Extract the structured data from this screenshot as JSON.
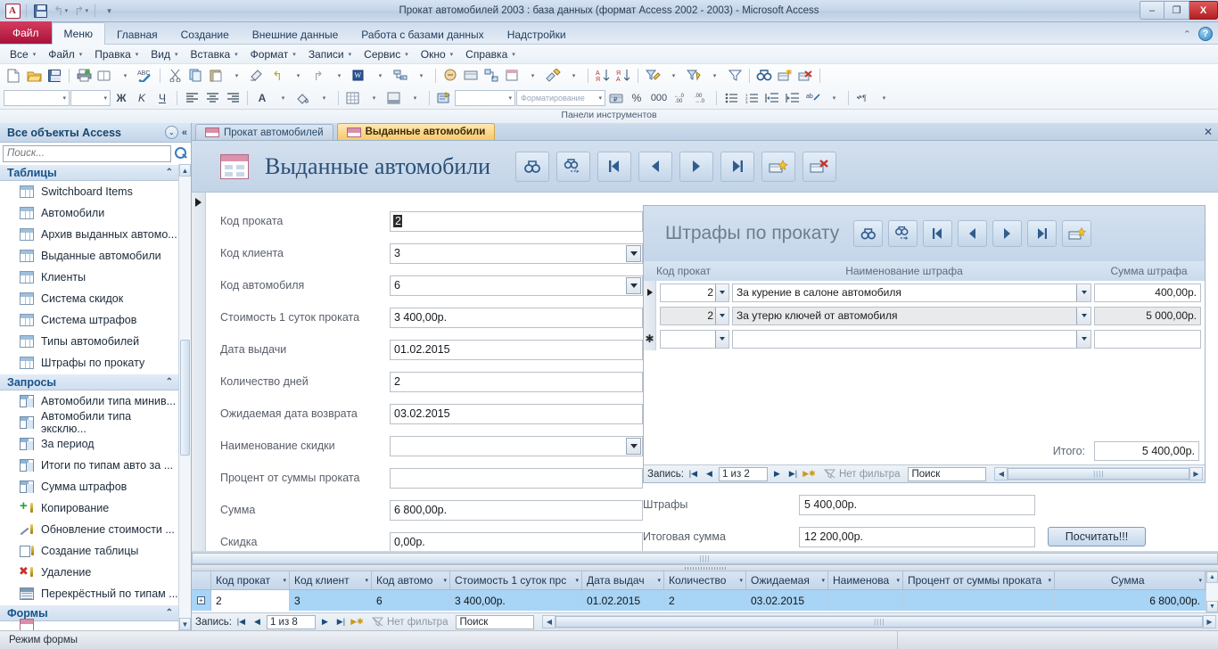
{
  "window": {
    "title": "Прокат автомобилей 2003 : база данных (формат Access 2002 - 2003)  -  Microsoft Access",
    "app_logo": "A",
    "minimize": "–",
    "restore": "❐",
    "close": "X"
  },
  "quick_access": [
    {
      "name": "save-icon",
      "label": ""
    },
    {
      "name": "undo-icon",
      "label": "↰"
    },
    {
      "name": "redo-icon",
      "label": "↱"
    },
    {
      "name": "customize-qat-icon",
      "label": "⌄"
    }
  ],
  "ribbon": {
    "file_tab": "Файл",
    "tabs": [
      {
        "label": "Меню",
        "active": true
      },
      {
        "label": "Главная",
        "active": false
      },
      {
        "label": "Создание",
        "active": false
      },
      {
        "label": "Внешние данные",
        "active": false
      },
      {
        "label": "Работа с базами данных",
        "active": false
      },
      {
        "label": "Надстройки",
        "active": false
      }
    ],
    "collapse_icon": "⌃",
    "help_icon": "?"
  },
  "menubar": [
    {
      "label": "Все"
    },
    {
      "label": "Файл"
    },
    {
      "label": "Правка"
    },
    {
      "label": "Вид"
    },
    {
      "label": "Вставка"
    },
    {
      "label": "Формат"
    },
    {
      "label": "Записи"
    },
    {
      "label": "Сервис"
    },
    {
      "label": "Окно"
    },
    {
      "label": "Справка"
    }
  ],
  "toolbar": {
    "caption": "Панели инструментов",
    "style_combo": "",
    "size_combo": "",
    "format_combo": "Форматирование",
    "bold": "Ж",
    "italic": "K",
    "underline": "Ч",
    "font_color": "A",
    "percent": "%",
    "thousands": "000"
  },
  "nav_pane": {
    "header": "Все объекты Access",
    "dropdown_icon": "⌄",
    "collapse_icon": "«",
    "search_placeholder": "Поиск...",
    "search_value": "",
    "search_icon": "search-icon",
    "groups": [
      {
        "label": "Таблицы",
        "chevron": "⌃",
        "icon_type": "table",
        "items": [
          "Switchboard Items",
          "Автомобили",
          "Архив выданных автомо...",
          "Выданные автомобили",
          "Клиенты",
          "Система скидок",
          "Система штрафов",
          "Типы автомобилей",
          "Штрафы по прокату"
        ]
      },
      {
        "label": "Запросы",
        "chevron": "⌃",
        "items": [
          {
            "label": "Автомобили типа минив...",
            "icon": "query"
          },
          {
            "label": "Автомобили типа экcклю...",
            "icon": "query"
          },
          {
            "label": "За период",
            "icon": "query"
          },
          {
            "label": "Итоги по типам авто за ...",
            "icon": "query"
          },
          {
            "label": "Сумма штрафов",
            "icon": "query"
          },
          {
            "label": "Копирование",
            "icon": "qappend"
          },
          {
            "label": "Обновление стоимости ...",
            "icon": "qupdate"
          },
          {
            "label": "Создание таблицы",
            "icon": "qmake"
          },
          {
            "label": "Удаление",
            "icon": "qdel"
          },
          {
            "label": "Перекрёстный по типам ...",
            "icon": "qcross"
          }
        ]
      },
      {
        "label": "Формы",
        "chevron": "⌃",
        "items": []
      }
    ],
    "scroll_up": "▲",
    "scroll_down": "▼"
  },
  "doc_tabs": [
    {
      "label": "Прокат автомобилей",
      "active": false
    },
    {
      "label": "Выданные автомобили",
      "active": true
    }
  ],
  "doc_tabs_close": "✕",
  "form": {
    "title": "Выданные автомобили",
    "nav_buttons": [
      {
        "name": "find-button",
        "icon": "binoculars-icon"
      },
      {
        "name": "find-next-button",
        "icon": "binoculars-next-icon"
      },
      {
        "name": "first-record-button",
        "icon": "first-record-icon"
      },
      {
        "name": "previous-record-button",
        "icon": "previous-record-icon"
      },
      {
        "name": "next-record-button",
        "icon": "next-record-icon"
      },
      {
        "name": "last-record-button",
        "icon": "last-record-icon"
      },
      {
        "name": "new-record-button",
        "icon": "new-record-icon"
      },
      {
        "name": "delete-record-button",
        "icon": "delete-record-icon"
      }
    ],
    "fields": [
      {
        "label": "Код проката",
        "value": "2",
        "type": "text",
        "selected": true
      },
      {
        "label": "Код клиента",
        "value": "3",
        "type": "combo"
      },
      {
        "label": "Код автомобиля",
        "value": "6",
        "type": "combo"
      },
      {
        "label": "Стоимость 1 суток проката",
        "value": "3 400,00р.",
        "type": "text"
      },
      {
        "label": "Дата выдачи",
        "value": "01.02.2015",
        "type": "text"
      },
      {
        "label": "Количество дней",
        "value": "2",
        "type": "text"
      },
      {
        "label": "Ожидаемая дата возврата",
        "value": "03.02.2015",
        "type": "text"
      },
      {
        "label": "Наименование скидки",
        "value": "",
        "type": "combo"
      },
      {
        "label": "Процент от суммы проката",
        "value": "",
        "type": "text"
      },
      {
        "label": "Сумма",
        "value": "6 800,00р.",
        "type": "text"
      },
      {
        "label": "Скидка",
        "value": "0,00р.",
        "type": "text"
      }
    ],
    "summary": [
      {
        "label": "Штрафы",
        "value": "5 400,00р."
      },
      {
        "label": "Итоговая сумма",
        "value": "12 200,00р."
      }
    ],
    "calc_button": "Посчитать!!!"
  },
  "subform": {
    "title": "Штрафы по прокату",
    "nav_buttons": [
      {
        "name": "sub-find-button",
        "icon": "binoculars-icon"
      },
      {
        "name": "sub-find-next-button",
        "icon": "binoculars-next-icon"
      },
      {
        "name": "sub-first-record-button",
        "icon": "first-record-icon"
      },
      {
        "name": "sub-previous-record-button",
        "icon": "previous-record-icon"
      },
      {
        "name": "sub-next-record-button",
        "icon": "next-record-icon"
      },
      {
        "name": "sub-last-record-button",
        "icon": "last-record-icon"
      },
      {
        "name": "sub-new-record-button",
        "icon": "new-record-icon"
      }
    ],
    "columns": [
      "Код прокат",
      "Наименование штрафа",
      "Сумма штрафа"
    ],
    "rows": [
      {
        "code": "2",
        "name": "За курение в салоне автомобиля",
        "amount": "400,00р.",
        "current": true
      },
      {
        "code": "2",
        "name": "За утерю ключей от автомобиля",
        "amount": "5 000,00р.",
        "current": false
      },
      {
        "code": "",
        "name": "",
        "amount": "",
        "new": true
      }
    ],
    "total_label": "Итого:",
    "total_value": "5 400,00р.",
    "record_nav": {
      "label": "Запись:",
      "first": "|◀",
      "prev": "◀",
      "position": "1 из 2",
      "next": "▶",
      "last": "▶|",
      "new": "▶✱",
      "filter": "Нет фильтра",
      "search": "Поиск"
    }
  },
  "datasheet": {
    "columns": [
      {
        "label": "Код прокат",
        "width": 88
      },
      {
        "label": "Код клиент",
        "width": 92
      },
      {
        "label": "Код автомо",
        "width": 88
      },
      {
        "label": "Стоимость 1 суток прс",
        "width": 148
      },
      {
        "label": "Дата выдач",
        "width": 92
      },
      {
        "label": "Количество",
        "width": 92
      },
      {
        "label": "Ожидаемая",
        "width": 92
      },
      {
        "label": "Наименова",
        "width": 84
      },
      {
        "label": "Процент от суммы проката",
        "width": 170
      },
      {
        "label": "Сумма",
        "width": 88
      }
    ],
    "sort_icon": "▾",
    "rows": [
      {
        "expand": "+",
        "cells": [
          "2",
          "3",
          "6",
          "3 400,00р.",
          "01.02.2015",
          "2",
          "03.02.2015",
          "",
          "",
          "6 800,00р."
        ]
      }
    ],
    "record_nav": {
      "label": "Запись:",
      "first": "|◀",
      "prev": "◀",
      "position": "1 из 8",
      "next": "▶",
      "last": "▶|",
      "new": "▶✱",
      "filter": "Нет фильтра",
      "search": "Поиск"
    },
    "scroll_up": "▲",
    "scroll_down": "▼"
  },
  "status_bar": {
    "mode": "Режим формы"
  }
}
